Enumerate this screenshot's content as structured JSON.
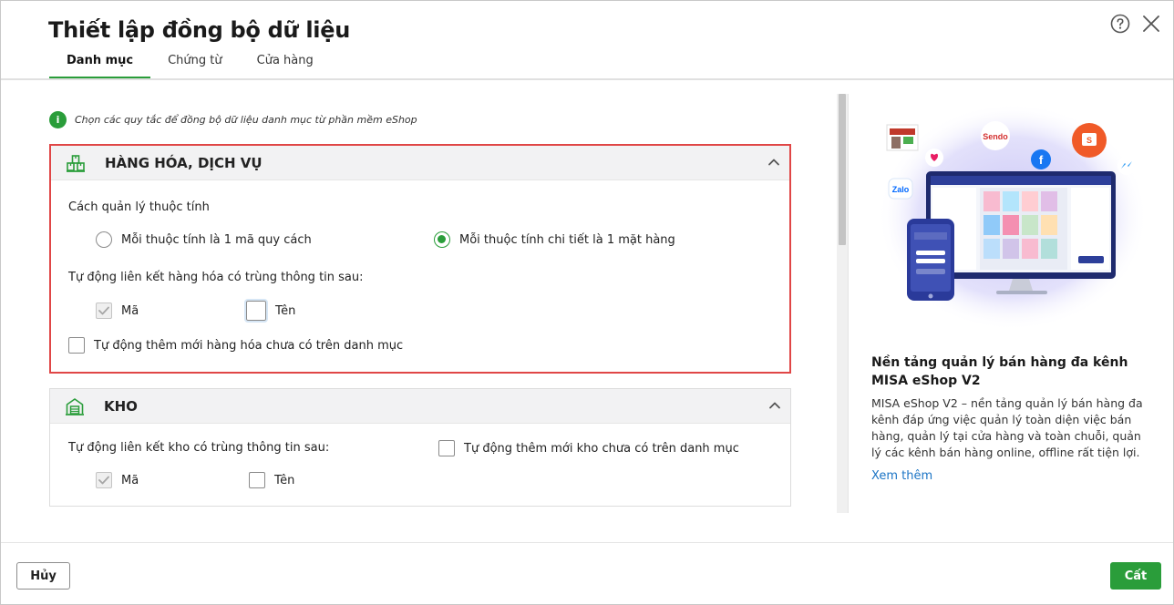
{
  "dialog": {
    "title": "Thiết lập đồng bộ dữ liệu",
    "help_icon": "help-circle-icon",
    "close_icon": "close-icon"
  },
  "tabs": [
    {
      "label": "Danh mục",
      "active": true
    },
    {
      "label": "Chứng từ",
      "active": false
    },
    {
      "label": "Cửa hàng",
      "active": false
    }
  ],
  "hint": {
    "icon": "info-icon",
    "symbol": "i",
    "text": "Chọn các quy tắc để đồng bộ dữ liệu danh mục từ phần mềm eShop"
  },
  "sections": {
    "goods": {
      "title": "HÀNG HÓA, DỊCH VỤ",
      "icon": "goods-warehouse-icon",
      "attribute_label": "Cách quản lý thuộc tính",
      "radio_options": [
        {
          "label": "Mỗi thuộc tính là 1 mã quy cách",
          "selected": false
        },
        {
          "label": "Mỗi thuộc tính chi tiết là 1 mặt hàng",
          "selected": true
        }
      ],
      "auto_link_label": "Tự động liên kết hàng hóa có trùng thông tin sau:",
      "link_options": [
        {
          "label": "Mã",
          "checked": true,
          "disabled": true
        },
        {
          "label": "Tên",
          "checked": false,
          "disabled": false
        }
      ],
      "auto_add_label": "Tự động thêm mới hàng hóa chưa có trên danh mục",
      "auto_add_checked": false
    },
    "warehouse": {
      "title": "KHO",
      "icon": "warehouse-icon",
      "auto_link_label": "Tự động liên kết kho có trùng thông tin sau:",
      "auto_add_label": "Tự động thêm mới kho chưa có trên danh mục",
      "auto_add_checked": false,
      "link_options": [
        {
          "label": "Mã",
          "checked": true,
          "disabled": true
        },
        {
          "label": "Tên",
          "checked": false,
          "disabled": false
        }
      ]
    }
  },
  "side_panel": {
    "title": "Nền tảng quản lý bán hàng đa kênh MISA eShop V2",
    "description": "MISA eShop V2 – nền tảng quản lý bán hàng đa kênh đáp ứng việc quản lý toàn diện việc bán hàng, quản lý tại cửa hàng và toàn chuỗi, quản lý các kênh bán hàng online, offline rất tiện lợi.",
    "link": "Xem thêm",
    "illustration": {
      "logos": [
        "Sendo",
        "Shopee",
        "Zalo",
        "f"
      ],
      "colors": {
        "bubble": "#dcd9f7",
        "monitor": "#1e2a6e",
        "phone": "#2a3a9a"
      }
    }
  },
  "footer": {
    "cancel_label": "Hủy",
    "save_label": "Cất"
  },
  "colors": {
    "accent": "#2a9d3a",
    "highlight_border": "#e04646",
    "link": "#1b74c5"
  }
}
